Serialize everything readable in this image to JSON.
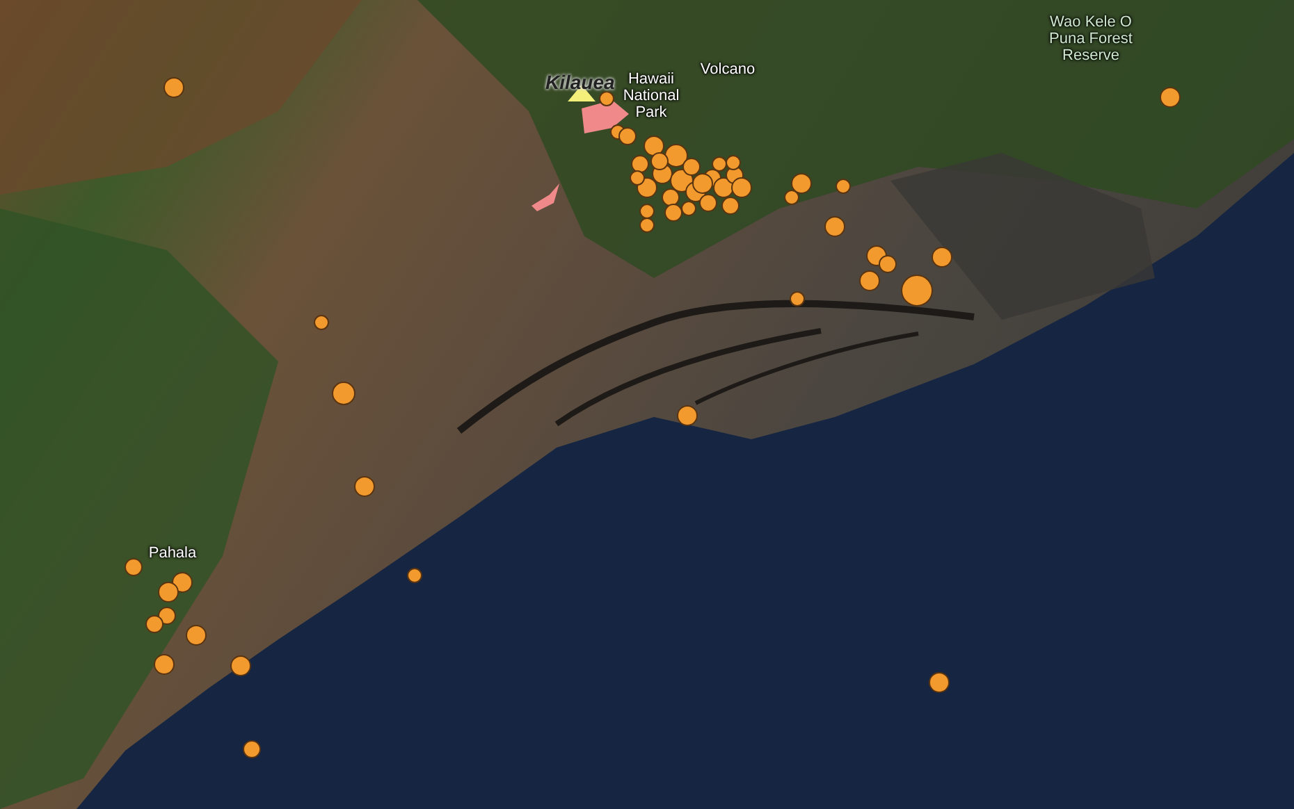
{
  "map": {
    "labels": [
      {
        "text": "Kilauea",
        "kind": "volcano"
      },
      {
        "text": "Hawaii National Park",
        "kind": "place"
      },
      {
        "text": "Volcano",
        "kind": "place"
      },
      {
        "text": "Wao Kele O Puna Forest Reserve",
        "kind": "place"
      },
      {
        "text": "Pahala",
        "kind": "place"
      }
    ]
  }
}
